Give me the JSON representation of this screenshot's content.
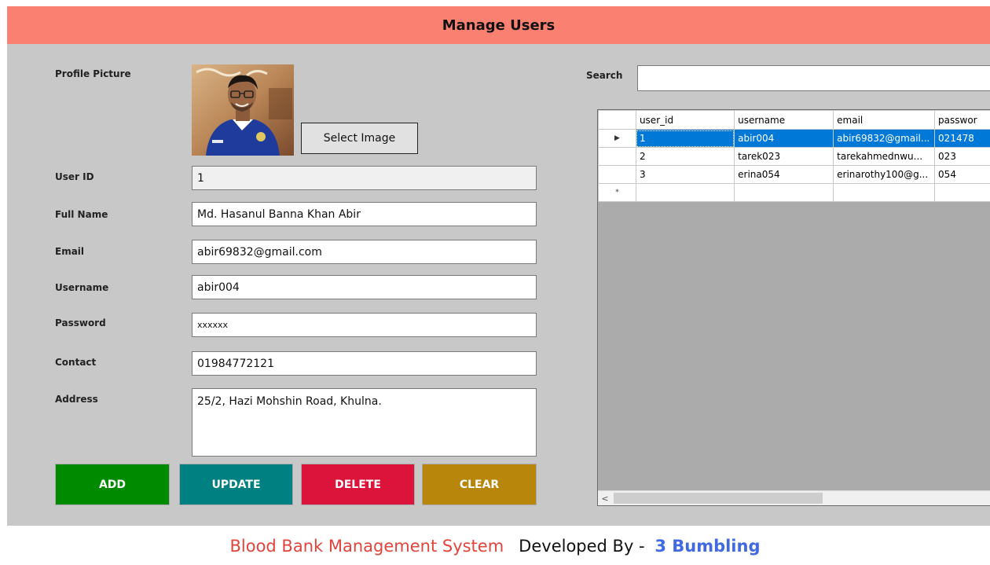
{
  "window": {
    "title": "Manage Users"
  },
  "form": {
    "profile_label": "Profile Picture",
    "select_image_label": "Select Image",
    "fields": {
      "user_id": {
        "label": "User ID",
        "value": "1"
      },
      "full_name": {
        "label": "Full Name",
        "value": "Md. Hasanul Banna Khan Abir"
      },
      "email": {
        "label": "Email",
        "value": "abir69832@gmail.com"
      },
      "username": {
        "label": "Username",
        "value": "abir004"
      },
      "password": {
        "label": "Password",
        "value": "xxxxxx"
      },
      "contact": {
        "label": "Contact",
        "value": "01984772121"
      },
      "address": {
        "label": "Address",
        "value": "25/2, Hazi Mohshin Road, Khulna."
      }
    }
  },
  "actions": {
    "add": {
      "label": "ADD",
      "color": "#008a00"
    },
    "update": {
      "label": "UPDATE",
      "color": "#008080"
    },
    "delete": {
      "label": "DELETE",
      "color": "#dc143c"
    },
    "clear": {
      "label": "CLEAR",
      "color": "#b8860b"
    }
  },
  "search": {
    "label": "Search",
    "value": ""
  },
  "grid": {
    "columns": [
      "user_id",
      "username",
      "email",
      "passwor"
    ],
    "rows": [
      [
        "1",
        "abir004",
        "abir69832@gmail...",
        "021478"
      ],
      [
        "2",
        "tarek023",
        "tarekahmednwu...",
        "023"
      ],
      [
        "3",
        "erina054",
        "erinarothy100@g...",
        "054"
      ]
    ],
    "selected_row_index": 0,
    "new_row_marker": "*",
    "current_row_marker": "▶",
    "scroll_left_glyph": "<"
  },
  "footer": {
    "app_name": "Blood Bank Management System",
    "developed_by": "Developed By - ",
    "team": "3 Bumbling",
    "colors": {
      "app_name": "#e0443c",
      "developed_by": "#111111",
      "team": "#4169e1"
    }
  },
  "colors": {
    "title_bar": "#fa8072",
    "window_bg": "#c8c8c8",
    "grid_selection": "#0078d7"
  }
}
